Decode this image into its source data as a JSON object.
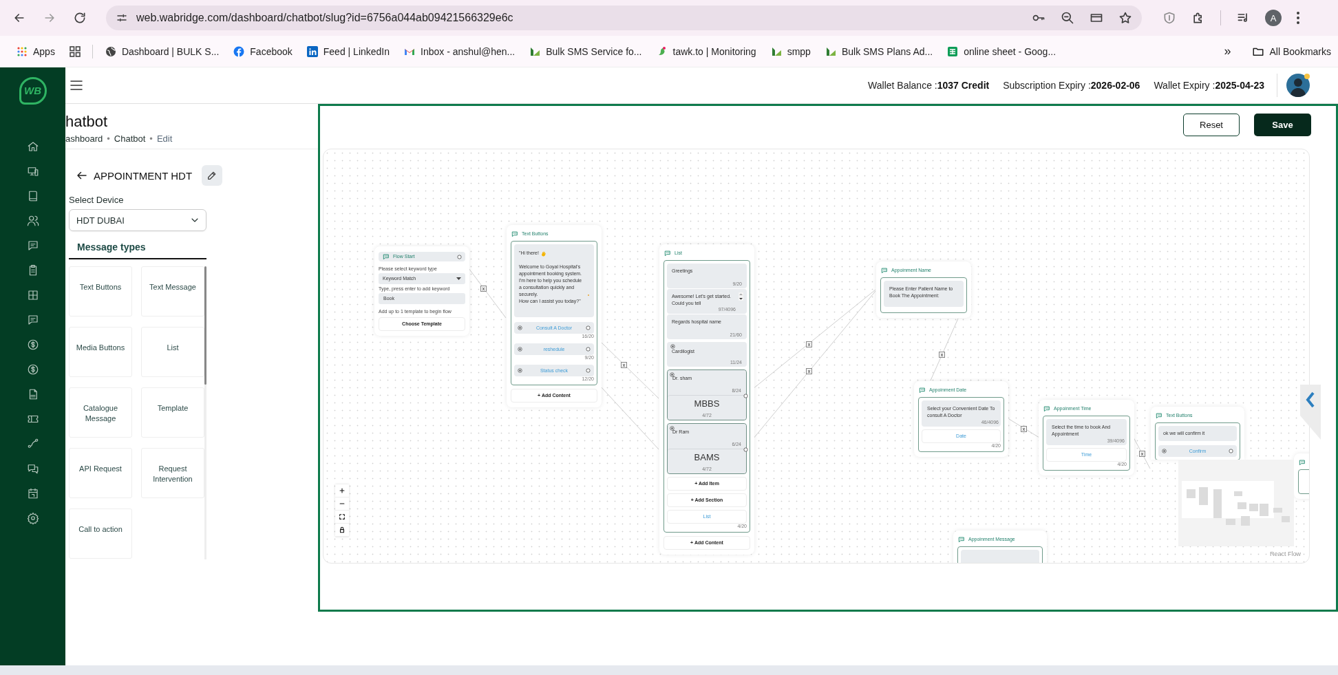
{
  "browser": {
    "url": "web.wabridge.com/dashboard/chatbot/slug?id=6756a044ab09421566329e6c",
    "profile_initial": "A",
    "bookmarks": [
      {
        "kind": "apps",
        "label": "Apps"
      },
      {
        "kind": "grid"
      },
      {
        "kind": "globe",
        "label": "Dashboard | BULK S..."
      },
      {
        "kind": "facebook",
        "label": "Facebook"
      },
      {
        "kind": "linkedin",
        "label": "Feed | LinkedIn"
      },
      {
        "kind": "gmail",
        "label": "Inbox - anshul@hen..."
      },
      {
        "kind": "bulksms",
        "label": "Bulk SMS Service fo..."
      },
      {
        "kind": "tawk",
        "label": "tawk.to | Monitoring"
      },
      {
        "kind": "bulksms",
        "label": "smpp"
      },
      {
        "kind": "bulksms",
        "label": "Bulk SMS Plans Ad..."
      },
      {
        "kind": "sheets",
        "label": "online sheet - Goog..."
      }
    ],
    "overflow": "»",
    "all_bookmarks": "All Bookmarks"
  },
  "sidebar": {
    "logo_text": "WB",
    "items": [
      {
        "kind": "home"
      },
      {
        "kind": "devices"
      },
      {
        "kind": "book"
      },
      {
        "kind": "users"
      },
      {
        "kind": "message"
      },
      {
        "kind": "clipboard"
      },
      {
        "kind": "grid"
      },
      {
        "kind": "message"
      },
      {
        "kind": "dollar"
      },
      {
        "kind": "dollar"
      },
      {
        "kind": "pdf"
      },
      {
        "kind": "ticket"
      },
      {
        "kind": "route"
      },
      {
        "kind": "chat"
      },
      {
        "kind": "calendar"
      },
      {
        "kind": "settings"
      }
    ]
  },
  "header": {
    "stats": [
      "Wallet Balance :**1037 Credit**",
      "Subscription Expiry :**2026-02-06**",
      "Wallet Expiry :**2025-04-23**"
    ]
  },
  "page": {
    "title": "hatbot",
    "breadcrumb": [
      {
        "kind": "link",
        "label": "ashboard"
      },
      {
        "kind": "separator",
        "label": "•"
      },
      {
        "kind": "link",
        "label": "Chatbot"
      },
      {
        "kind": "separator",
        "label": "•"
      },
      {
        "kind": "current",
        "label": "Edit"
      }
    ]
  },
  "builder": {
    "flow_name": "APPOINTMENT HDT",
    "device_label": "Select Device",
    "device": "HDT DUBAI",
    "tabs": [
      {
        "label": "Message types",
        "selected": true
      }
    ],
    "message_types": [
      "Text Buttons",
      "Text Message",
      "Media Buttons",
      "List",
      "Catalogue Message",
      "Template",
      "API Request",
      "Request Intervention",
      "Call to action"
    ]
  },
  "actions": {
    "reset": "Reset",
    "save": "Save"
  },
  "canvas": {
    "nodes": [
      {
        "kind": "flow_start",
        "title": "Flow Start",
        "keyword_label": "Please select keyword type",
        "keyword_type": "Keyword Match",
        "keyword_hint": "Type, press enter to add keyword",
        "keyword": "Book",
        "template_hint": "Add up to 1 template to begin flow",
        "template_button": "Choose Template"
      },
      {
        "kind": "text_buttons",
        "title": "Text Buttons",
        "message_parts": [
          {
            "kind": "with_wave",
            "text": "\"Hi there!"
          },
          {
            "kind": "with_smile",
            "text": "Welcome to Goyal Hospital's appointment booking system. I'm here to help you schedule a consultation quickly and securely."
          },
          {
            "kind": "plain",
            "text": "How can I assist you today?\""
          }
        ],
        "buttons": [
          {
            "kind": "labeled",
            "label": "Consult A Doctor",
            "count": "16/20"
          },
          {
            "kind": "labeled",
            "label": "reshedule",
            "count": "9/20"
          },
          {
            "kind": "labeled",
            "label": "Status check",
            "count": "12/20"
          }
        ],
        "add_content": "+ Add Content"
      },
      {
        "kind": "list",
        "title": "List",
        "fields": [
          {
            "kind": "field",
            "text": "Greetings",
            "count": "9/20",
            "scrollable": false
          },
          {
            "kind": "field",
            "text": "Awesome! Let's get started. Could you tell",
            "count": "97/4096",
            "scrollable": true
          },
          {
            "kind": "field",
            "text": "Regards hospital name",
            "count": "21/60",
            "scrollable": false
          },
          {
            "kind": "section",
            "text": "Cardilogist",
            "count": "11/24",
            "scrollable": false
          },
          {
            "kind": "item",
            "text": "Dr. sham",
            "count": "8/24",
            "description": "MBBS",
            "description_count": "4/72",
            "scrollable": false
          },
          {
            "kind": "item",
            "text": "Dr Ram",
            "count": "6/24",
            "description": "BAMS",
            "description_count": "4/72",
            "scrollable": false
          }
        ],
        "add_item": "+ Add Item",
        "add_section": "+ Add Section",
        "button": {
          "label": "List",
          "count": "4/20"
        },
        "add_content": "+ Add Content"
      },
      {
        "kind": "question",
        "title": "Appoinment Name",
        "text": "Please Enter Patient Name to Book The Appointment:"
      },
      {
        "kind": "question",
        "title": "Appoinment Date",
        "text": "Select your Convenient Date To consult A Doctor",
        "count": "46/4096",
        "button": {
          "label": "Date",
          "count": "4/20"
        }
      },
      {
        "kind": "question",
        "title": "Appoinment Time",
        "text": "Select the time to book And Appointment",
        "count": "39/4096",
        "button": {
          "label": "Time",
          "count": "4/20"
        }
      },
      {
        "kind": "text_buttons",
        "title": "Text Buttons",
        "message_parts": [
          {
            "kind": "plain",
            "text": "ok we will confirm it"
          }
        ],
        "buttons": [
          {
            "kind": "labeled",
            "label": "Confirm"
          }
        ]
      },
      {
        "kind": "stub",
        "title": "Appoinment Message"
      },
      {
        "kind": "edge_stub"
      }
    ],
    "edges": [
      {
        "kind": "labeled",
        "label": "x"
      },
      {
        "kind": "labeled",
        "label": "x"
      },
      {
        "kind": "plain"
      },
      {
        "kind": "labeled",
        "label": "x"
      },
      {
        "kind": "labeled",
        "label": "x"
      },
      {
        "kind": "labeled",
        "label": "x"
      },
      {
        "kind": "labeled",
        "label": "x"
      },
      {
        "kind": "labeled",
        "label": "x"
      }
    ],
    "controls": [
      {
        "kind": "zoom_in"
      },
      {
        "kind": "zoom_out"
      },
      {
        "kind": "fit"
      },
      {
        "kind": "lock"
      }
    ],
    "attribution": "React Flow"
  }
}
